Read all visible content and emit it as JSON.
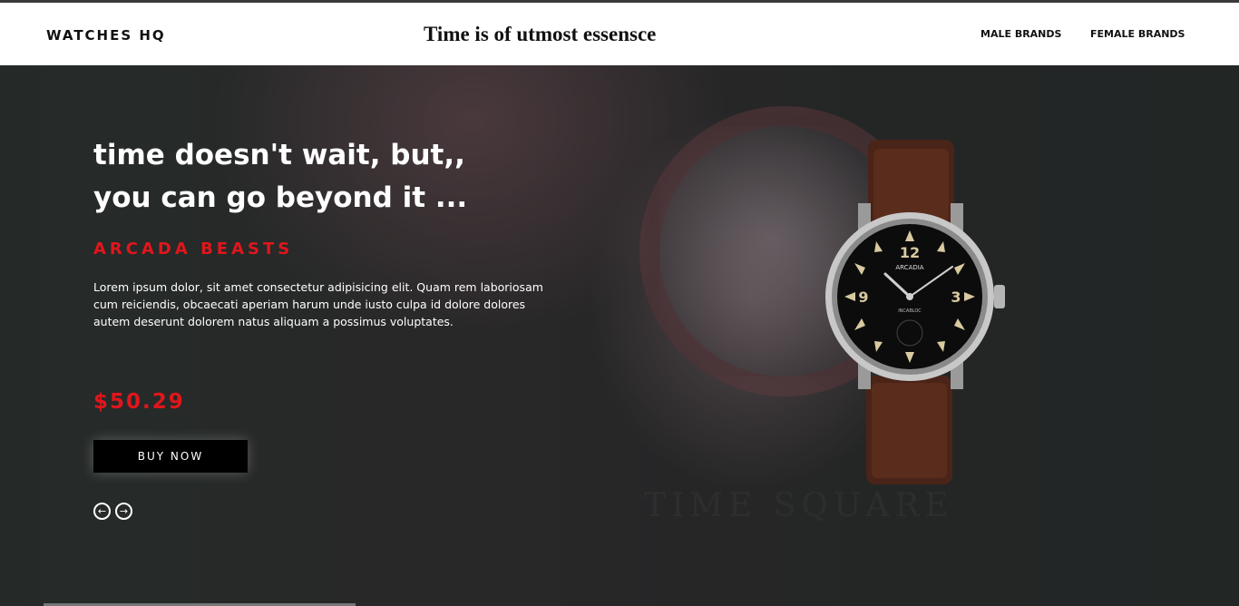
{
  "header": {
    "logo": "WATCHES HQ",
    "tagline": "Time is of utmost essensce",
    "nav": {
      "male": "MALE BRANDS",
      "female": "FEMALE BRANDS"
    }
  },
  "hero": {
    "headline_line1": "time doesn't wait, but,,",
    "headline_line2": "you can go beyond it ...",
    "brand": "ARCADA BEASTS",
    "description": "Lorem ipsum dolor, sit amet consectetur adipisicing elit. Quam rem laboriosam cum reiciendis, obcaecati aperiam harum unde iusto culpa id dolore dolores autem deserunt dolorem natus aliquam a possimus voluptates.",
    "price": "$50.29",
    "buy_label": "BUY NOW",
    "watermark": "TIME SQUARE",
    "watch_dial": {
      "brand": "ARCADIA",
      "model": "INCABLOC",
      "numerals": [
        "12",
        "9",
        "3"
      ]
    },
    "icons": {
      "prev": "circle-arrow-left-icon",
      "next": "circle-arrow-right-icon"
    }
  },
  "colors": {
    "accent": "#e0161c",
    "header_bg": "#ffffff",
    "hero_bg": "#262a28"
  }
}
